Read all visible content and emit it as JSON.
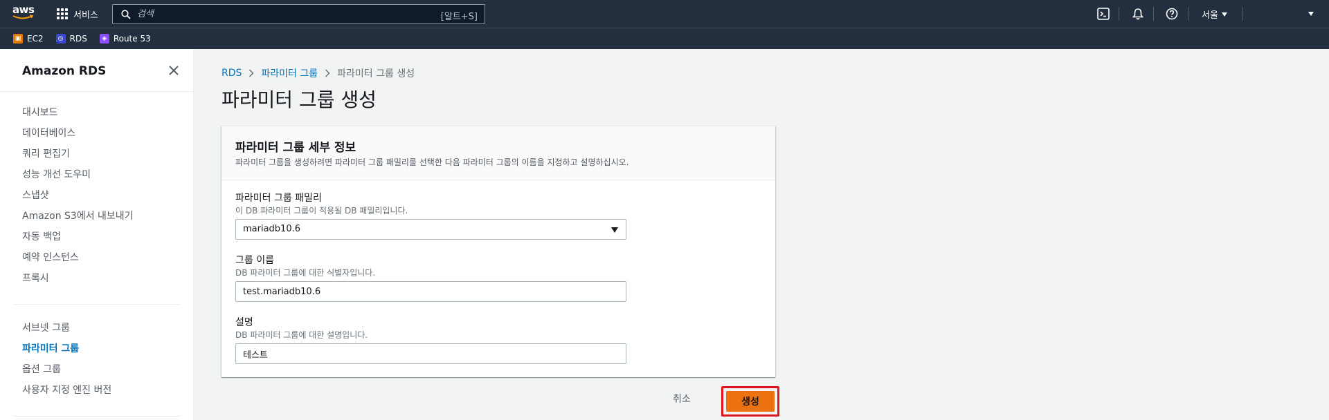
{
  "topbar": {
    "logo_text": "aws",
    "services_label": "서비스",
    "search_placeholder": "검색",
    "search_shortcut": "[알트+S]",
    "region_label": "서울"
  },
  "favorites": [
    {
      "label": "EC2",
      "color": "#e07b00",
      "icon": "ec2-icon"
    },
    {
      "label": "RDS",
      "color": "#3b48cc",
      "icon": "rds-icon"
    },
    {
      "label": "Route 53",
      "color": "#8c4fff",
      "icon": "route53-icon"
    }
  ],
  "sidebar": {
    "title": "Amazon RDS",
    "items_primary": [
      "대시보드",
      "데이터베이스",
      "쿼리 편집기",
      "성능 개선 도우미",
      "스냅샷",
      "Amazon S3에서 내보내기",
      "자동 백업",
      "예약 인스턴스",
      "프록시"
    ],
    "items_secondary": [
      "서브넷 그룹",
      "파라미터 그룹",
      "옵션 그룹",
      "사용자 지정 엔진 버전"
    ],
    "active_item": "파라미터 그룹"
  },
  "breadcrumb": {
    "root": "RDS",
    "parent": "파라미터 그룹",
    "current": "파라미터 그룹 생성"
  },
  "page_title": "파라미터 그룹 생성",
  "panel": {
    "title": "파라미터 그룹 세부 정보",
    "description": "파라미터 그룹을 생성하려면 파라미터 그룹 패밀리를 선택한 다음 파라미터 그룹의 이름을 지정하고 설명하십시오.",
    "family": {
      "label": "파라미터 그룹 패밀리",
      "description": "이 DB 파라미터 그룹이 적용될 DB 패밀리입니다.",
      "value": "mariadb10.6"
    },
    "group_name": {
      "label": "그룹 이름",
      "description": "DB 파라미터 그룹에 대한 식별자입니다.",
      "value": "test.mariadb10.6"
    },
    "description_field": {
      "label": "설명",
      "description": "DB 파라미터 그룹에 대한 설명입니다.",
      "value": "테스트"
    }
  },
  "actions": {
    "cancel_label": "취소",
    "create_label": "생성"
  }
}
